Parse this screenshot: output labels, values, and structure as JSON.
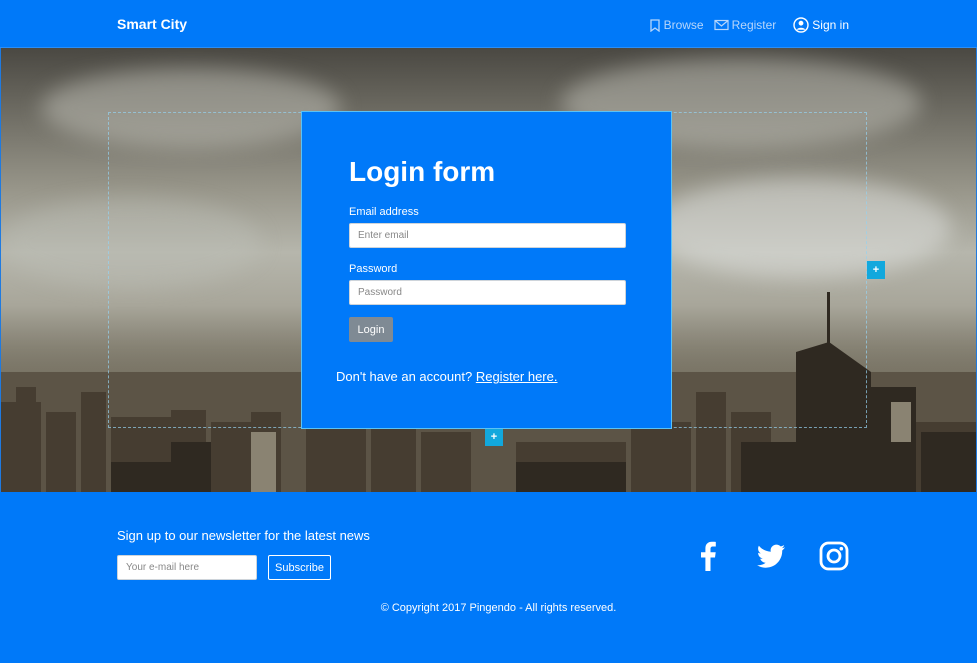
{
  "navbar": {
    "brand": "Smart City",
    "links": [
      {
        "label": "Browse",
        "icon": "bookmark-icon"
      },
      {
        "label": "Register",
        "icon": "envelope-icon"
      },
      {
        "label": "Sign in",
        "icon": "user-circle-icon"
      }
    ]
  },
  "login": {
    "title": "Login form",
    "email_label": "Email address",
    "email_placeholder": "Enter email",
    "email_value": "",
    "password_label": "Password",
    "password_placeholder": "Password",
    "password_value": "",
    "button_label": "Login",
    "register_prompt": "Don't have an account?",
    "register_link": "Register here."
  },
  "editor": {
    "add_handle_label": "+"
  },
  "footer": {
    "newsletter_text": "Sign up to our newsletter for the latest news",
    "newsletter_placeholder": "Your e-mail here",
    "subscribe_label": "Subscribe",
    "social": [
      "facebook-icon",
      "twitter-icon",
      "instagram-icon"
    ],
    "copyright": "© Copyright 2017 Pingendo - All rights reserved."
  },
  "colors": {
    "primary": "#0079f9",
    "button_gray": "#7f8a94",
    "guide_cyan": "#12a8dd"
  }
}
